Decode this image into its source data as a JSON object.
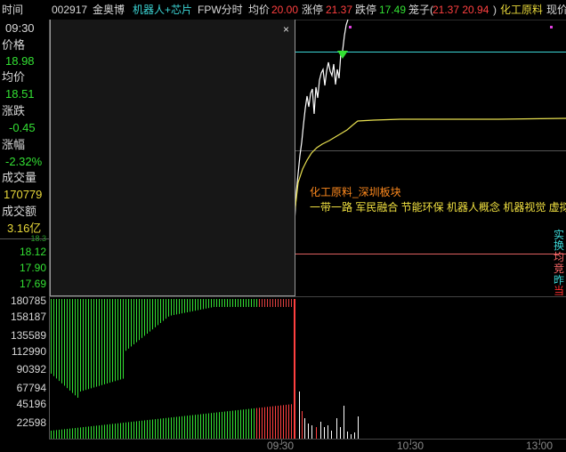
{
  "header": {
    "time_label": "时间",
    "stock_code": "002917",
    "stock_name": "金奥博",
    "tags": "机器人+芯片",
    "chart_mode": "FPW分时",
    "avg_label": "均价",
    "avg_value": "20.00",
    "limit_up_label": "涨停",
    "limit_up_value": "21.37",
    "limit_down_label": "跌停",
    "limit_down_value": "17.49",
    "cage_label": "笼子(",
    "cage_values": "21.37 20.94",
    "cage_close": ")",
    "sector": "化工原料",
    "current_price_label": "现价"
  },
  "info_panel": {
    "time": "09:30",
    "price_label": "价格",
    "price": "18.98",
    "avg_label": "均价",
    "avg": "18.51",
    "change_label": "涨跌",
    "change": "-0.45",
    "pct_label": "涨幅",
    "pct": "-2.32%",
    "volume_label": "成交量",
    "volume": "170779",
    "amount_label": "成交额",
    "amount": "3.16亿"
  },
  "price_axis": {
    "partial_top": "18.3",
    "labels": [
      "18.12",
      "17.90",
      "17.69"
    ]
  },
  "volume_axis": {
    "labels": [
      "180785",
      "158187",
      "135589",
      "112990",
      "90392",
      "67794",
      "45196",
      "22598"
    ]
  },
  "time_axis": {
    "labels": [
      "09:30",
      "10:30",
      "13:00"
    ]
  },
  "overlay": {
    "block_name": "化工原料_深圳板块",
    "concepts": "一带一路  军民融合  节能环保  机器人概念  机器视觉  虚拟"
  },
  "right_side": {
    "items": [
      {
        "text": "实",
        "color": "#3cd6d6"
      },
      {
        "text": "换",
        "color": "#3cd6d6"
      },
      {
        "text": "均",
        "color": "#ff6a6a"
      },
      {
        "text": "竞",
        "color": "#ff6a6a"
      },
      {
        "text": "昨",
        "color": "#3cd6d6"
      },
      {
        "text": "当",
        "color": "#ff3030"
      }
    ]
  },
  "popup": {
    "close_glyph": "×"
  },
  "colors": {
    "up": "#ff4040",
    "down": "#33e033",
    "avg_line": "#e8e050",
    "price_line": "#ffffff",
    "limit_line": "#3cd6d6"
  }
}
